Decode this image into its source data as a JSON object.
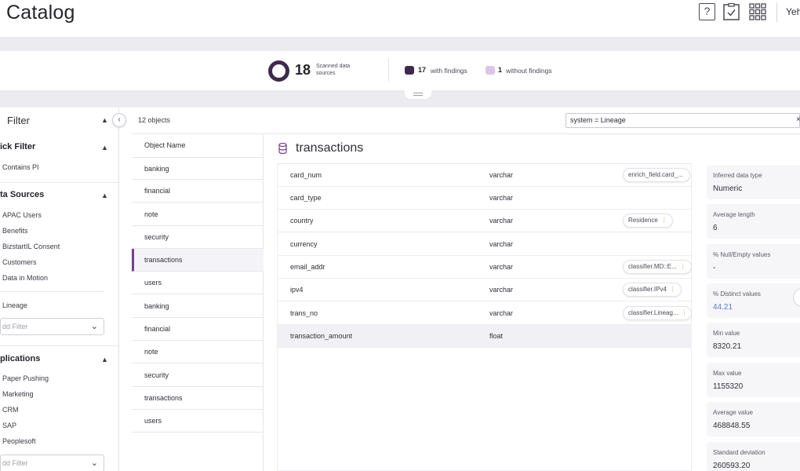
{
  "header": {
    "title": "Catalog",
    "help_glyph": "?",
    "user": "Yeh"
  },
  "summary": {
    "scanned_count": "18",
    "scanned_label": "Scanned data sources",
    "with_findings_count": "17",
    "with_findings_label": "with findings",
    "without_findings_count": "1",
    "without_findings_label": "without findings",
    "colors": {
      "with": "#3e2a4d",
      "without": "#dcc4e6"
    }
  },
  "filter": {
    "title": "Filter",
    "collapse_glyph": "‹",
    "quick_filter": {
      "title": "ick Filter",
      "items": [
        "Contains PI"
      ]
    },
    "data_sources": {
      "title": "ta Sources",
      "items": [
        "APAC Users",
        "Benefits",
        "BizstartIL Consent",
        "Customers",
        "Data in Motion"
      ],
      "extra": "Lineage",
      "add_placeholder": "dd Filter"
    },
    "applications": {
      "title": "plications",
      "items": [
        "Paper Pushing",
        "Marketing",
        "CRM",
        "SAP",
        "Peoplesoft"
      ],
      "add_placeholder": "dd Filter"
    }
  },
  "objects": {
    "count": "12 objects",
    "search_value": "system = Lineage",
    "clear_glyph": "×",
    "header": "Object Name",
    "items": [
      "banking",
      "financial",
      "note",
      "security",
      "transactions",
      "users",
      "banking",
      "financial",
      "note",
      "security",
      "transactions",
      "users"
    ],
    "active_index": 4
  },
  "detail": {
    "title": "transactions",
    "fields": [
      {
        "name": "card_num",
        "type": "varchar",
        "tag": "enrich_field.card_..."
      },
      {
        "name": "card_type",
        "type": "varchar",
        "tag": ""
      },
      {
        "name": "country",
        "type": "varchar",
        "tag": "Residence"
      },
      {
        "name": "currency",
        "type": "varchar",
        "tag": ""
      },
      {
        "name": "email_addr",
        "type": "varchar",
        "tag": "classifier.MD::E..."
      },
      {
        "name": "ipv4",
        "type": "varchar",
        "tag": "classifier.IPv4"
      },
      {
        "name": "trans_no",
        "type": "varchar",
        "tag": "classifier.Lineag..."
      },
      {
        "name": "transaction_amount",
        "type": "float",
        "tag": ""
      }
    ],
    "active_field": 7
  },
  "stats": [
    {
      "label": "Inferred data type",
      "value": "Numeric"
    },
    {
      "label": "Average length",
      "value": "6"
    },
    {
      "label": "% Null/Empty values",
      "value": "-"
    },
    {
      "label": "% Distinct values",
      "value": "44.21"
    },
    {
      "label": "Min value",
      "value": "8320.21"
    },
    {
      "label": "Max value",
      "value": "1155320"
    },
    {
      "label": "Average value",
      "value": "468848.55"
    },
    {
      "label": "Standard deviation",
      "value": "260593.20"
    }
  ]
}
